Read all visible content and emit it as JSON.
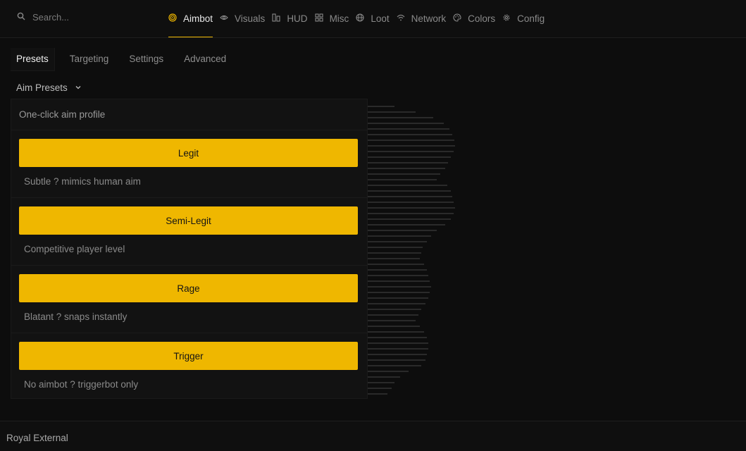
{
  "search": {
    "placeholder": "Search..."
  },
  "nav": [
    {
      "label": "Aimbot",
      "icon": "target-icon",
      "active": true
    },
    {
      "label": "Visuals",
      "icon": "eye-icon"
    },
    {
      "label": "HUD",
      "icon": "hud-icon"
    },
    {
      "label": "Misc",
      "icon": "grid-icon"
    },
    {
      "label": "Loot",
      "icon": "globe-icon"
    },
    {
      "label": "Network",
      "icon": "wifi-icon"
    },
    {
      "label": "Colors",
      "icon": "palette-icon"
    },
    {
      "label": "Config",
      "icon": "gear-icon"
    }
  ],
  "subtabs": [
    "Presets",
    "Targeting",
    "Settings",
    "Advanced"
  ],
  "section": {
    "title": "Aim Presets"
  },
  "panel": {
    "heading": "One-click aim profile",
    "presets": [
      {
        "label": "Legit",
        "desc": "Subtle ? mimics human aim"
      },
      {
        "label": "Semi-Legit",
        "desc": "Competitive player level"
      },
      {
        "label": "Rage",
        "desc": "Blatant ? snaps instantly"
      },
      {
        "label": "Trigger",
        "desc": "No aimbot ? triggerbot only"
      }
    ]
  },
  "footer": {
    "label": "Royal External"
  },
  "colors": {
    "accent": "#efb700",
    "background": "#0d0d0d",
    "panel": "#121212"
  }
}
